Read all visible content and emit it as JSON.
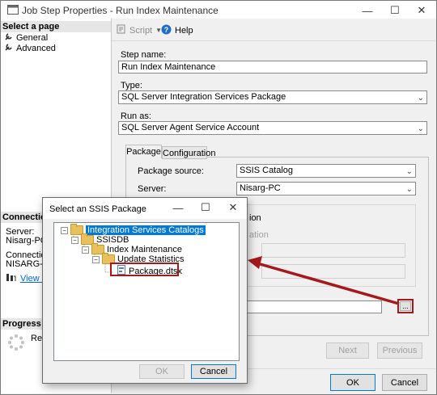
{
  "window": {
    "title": "Job Step Properties - Run Index Maintenance"
  },
  "left_pane": {
    "select_page_header": "Select a page",
    "pages": [
      {
        "label": "General",
        "icon": "wrench-icon"
      },
      {
        "label": "Advanced",
        "icon": "wrench-icon"
      }
    ],
    "connection_header": "Connection",
    "server_label": "Server:",
    "server_value": "Nisarg-PC",
    "connection_label": "Connection:",
    "connection_value": "NISARG-PC",
    "view_link": "View co",
    "progress_header": "Progress",
    "progress_status": "Rea"
  },
  "toolbar": {
    "script_label": "Script",
    "help_label": "Help"
  },
  "form": {
    "step_name_label": "Step name:",
    "step_name_value": "Run Index Maintenance",
    "type_label": "Type:",
    "type_value": "SQL Server Integration Services Package",
    "run_as_label": "Run as:",
    "run_as_value": "SQL Server Agent Service Account"
  },
  "tabs": {
    "package_tab": "Package",
    "configuration_tab": "Configuration"
  },
  "package": {
    "source_label": "Package source:",
    "source_value": "SSIS Catalog",
    "server_label": "Server:",
    "server_value": "Nisarg-PC",
    "partial_text_1": "ion",
    "partial_text_2": "ation",
    "browse_label": "...",
    "next_label": "Next",
    "previous_label": "Previous"
  },
  "footer": {
    "ok_label": "OK",
    "cancel_label": "Cancel"
  },
  "dialog": {
    "title": "Select an SSIS Package",
    "tree": {
      "root": "Integration Services Catalogs",
      "catalog": "SSISDB",
      "folder": "Index Maintenance",
      "project": "Update Statistics",
      "package": "Package.dtsx"
    },
    "ok_label": "OK",
    "cancel_label": "Cancel"
  },
  "colors": {
    "highlight": "#a5191d",
    "selection": "#0078d7",
    "link": "#0066cc"
  }
}
